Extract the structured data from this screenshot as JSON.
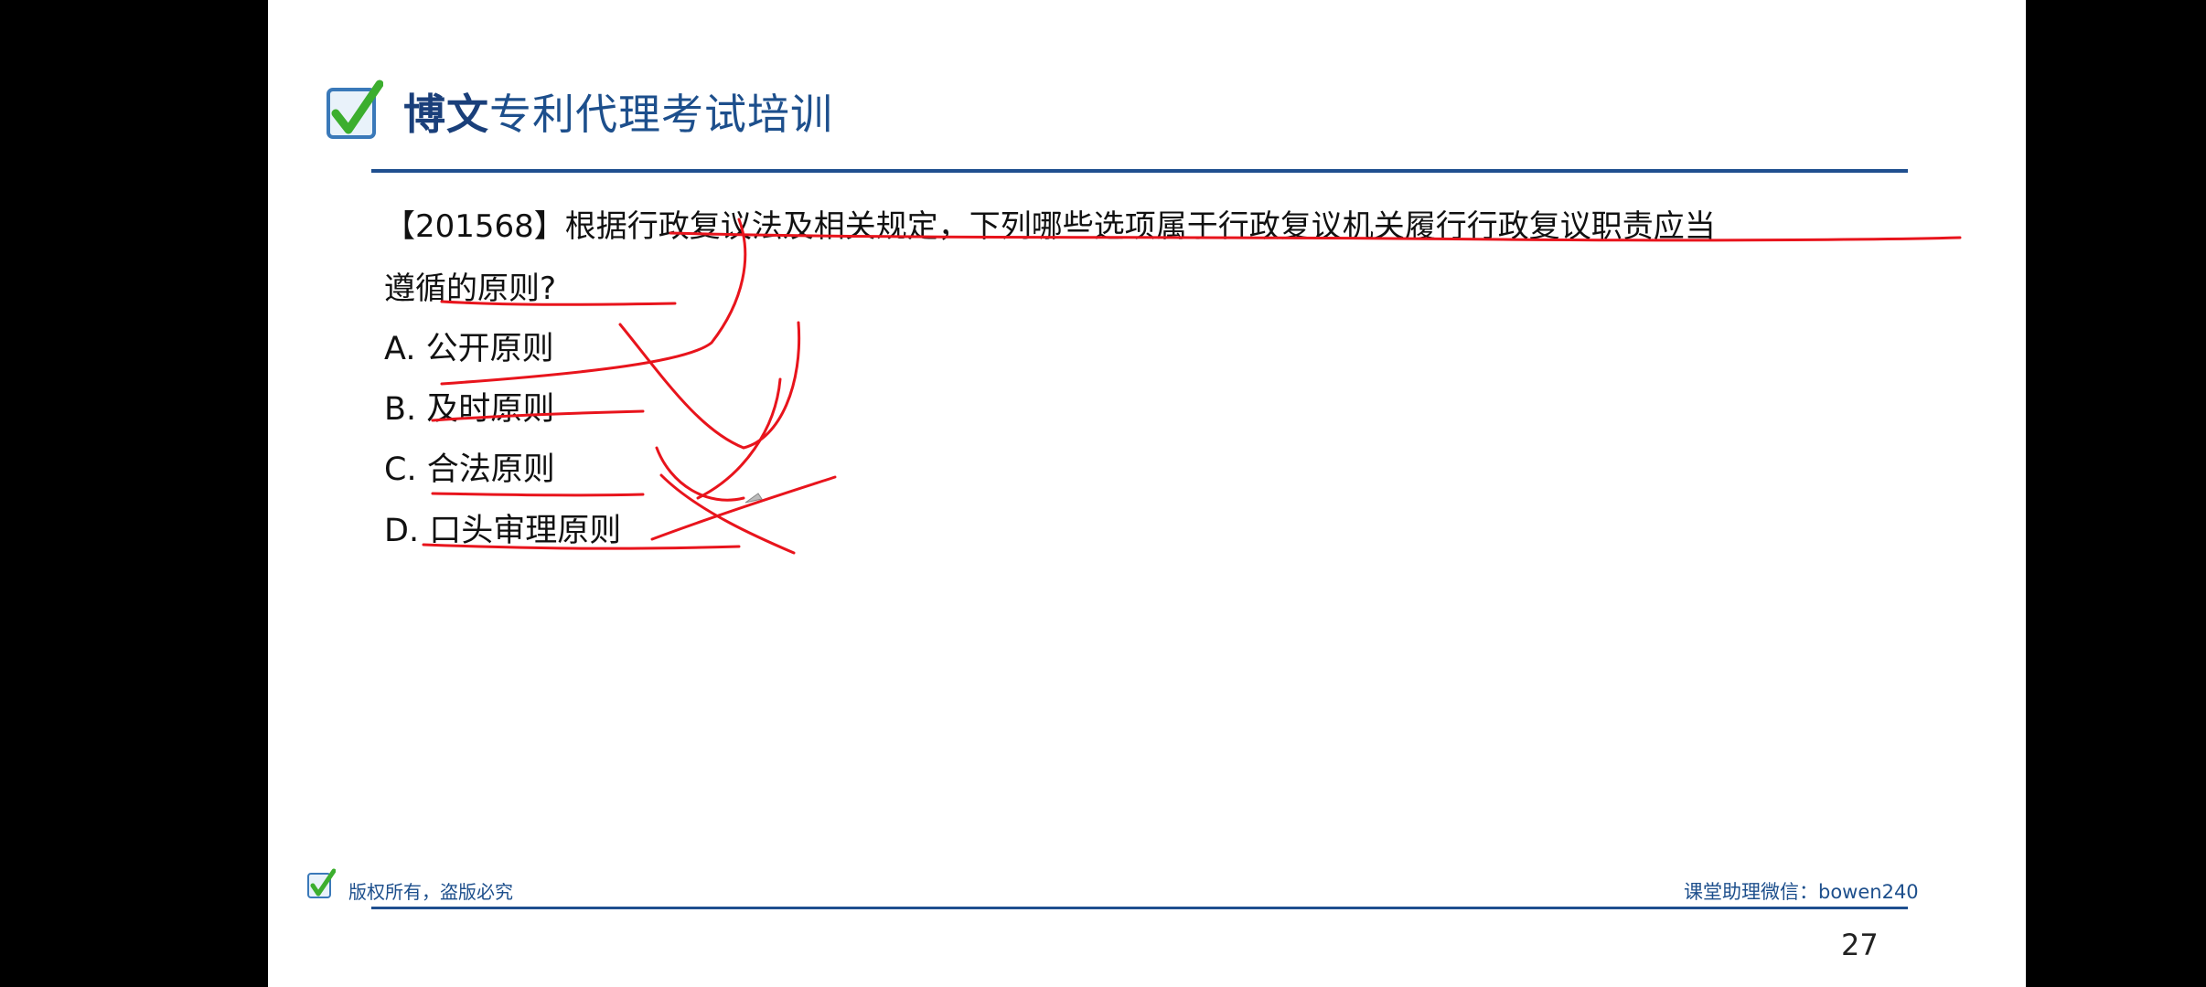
{
  "slide": {
    "brand_bold": "博文",
    "brand_rest": "专利代理考试培训",
    "question_line1": "【201568】根据行政复议法及相关规定，下列哪些选项属于行政复议机关履行行政复议职责应当",
    "question_line2": "遵循的原则?",
    "options": [
      {
        "letter": "A.",
        "text": "公开原则"
      },
      {
        "letter": "B.",
        "text": "及时原则"
      },
      {
        "letter": "C.",
        "text": "合法原则"
      },
      {
        "letter": "D.",
        "text": "口头审理原则"
      }
    ],
    "footer_copyright": "版权所有，盗版必究",
    "footer_wechat": "课堂助理微信：bowen240",
    "page_number": "27"
  },
  "colors": {
    "brand_blue": "#1d4f8c",
    "rule_blue": "#1f4f8f",
    "ink_red": "#e8141c",
    "check_green": "#3cae2e"
  },
  "icons": {
    "logo": "green-checkmark-icon",
    "webcam": "presenter-video-feed"
  }
}
